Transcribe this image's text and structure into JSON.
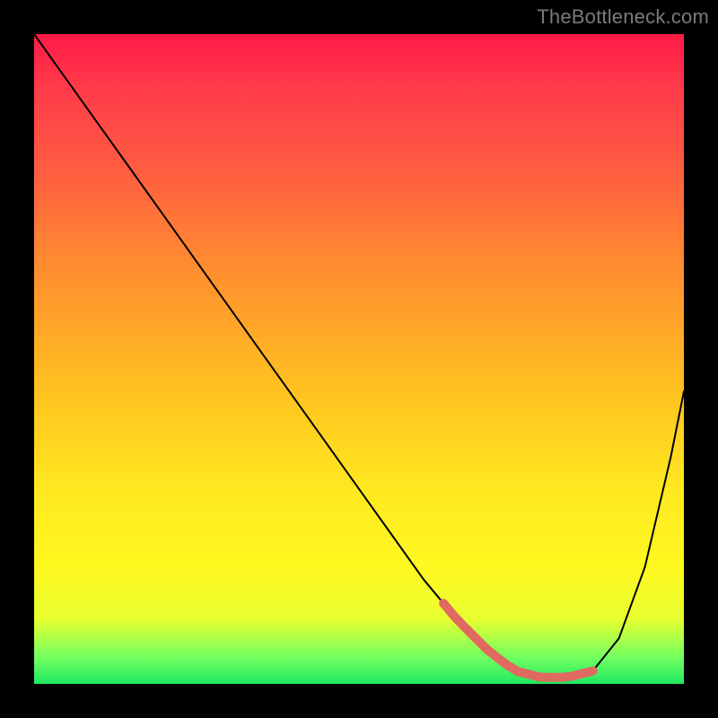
{
  "watermark": "TheBottleneck.com",
  "chart_data": {
    "type": "line",
    "title": "",
    "xlabel": "",
    "ylabel": "",
    "xlim": [
      0,
      100
    ],
    "ylim": [
      0,
      100
    ],
    "grid": false,
    "background_gradient": [
      "#ff1a47",
      "#ff8a30",
      "#ffe820",
      "#20e860"
    ],
    "series": [
      {
        "name": "bottleneck-curve",
        "x": [
          0,
          5,
          10,
          15,
          20,
          25,
          30,
          35,
          40,
          45,
          50,
          55,
          60,
          65,
          70,
          74,
          78,
          82,
          86,
          90,
          94,
          98,
          100
        ],
        "y": [
          100,
          93,
          86,
          79,
          72,
          65,
          58,
          51,
          44,
          37,
          30,
          23,
          16,
          10,
          5,
          2,
          1,
          1,
          2,
          7,
          18,
          35,
          45
        ]
      }
    ],
    "highlight_range": {
      "name": "optimal-zone",
      "color": "#e06a5f",
      "x": [
        63,
        86
      ],
      "y_approx": [
        3,
        3
      ]
    }
  }
}
